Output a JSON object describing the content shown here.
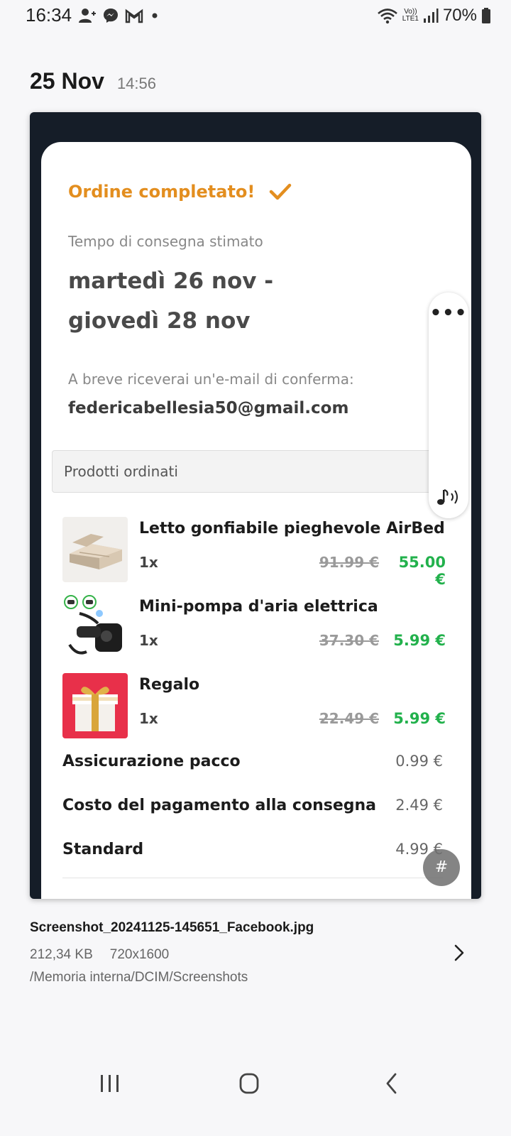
{
  "status_bar": {
    "time": "16:34",
    "notification_icons": [
      "person-add-icon",
      "messenger-icon",
      "gmail-icon",
      "dot-icon"
    ],
    "lte_top": "Vo))",
    "lte_bottom": "LTE1",
    "battery": "70%"
  },
  "gallery": {
    "date": "25 Nov",
    "time": "14:56"
  },
  "order": {
    "title": "Ordine completato!",
    "delivery_label": "Tempo di consegna stimato",
    "delivery_line1": "martedì 26 nov -",
    "delivery_line2": "giovedì 28 nov",
    "email_label": "A breve riceverai un'e-mail di conferma:",
    "email": "federicabellesia50@gmail.com",
    "products_header": "Prodotti ordinati",
    "items": [
      {
        "name": "Letto gonfiabile pieghevole AirBed",
        "qty": "1x",
        "old_price": "91.99 €",
        "new_price": "55.00 €"
      },
      {
        "name": "Mini-pompa d'aria elettrica",
        "qty": "1x",
        "old_price": "37.30 €",
        "new_price": "5.99 €"
      },
      {
        "name": "Regalo",
        "qty": "1x",
        "old_price": "22.49 €",
        "new_price": "5.99 €"
      }
    ],
    "fees": [
      {
        "label": "Assicurazione pacco",
        "value": "0.99 €"
      },
      {
        "label": "Costo del pagamento alla consegna",
        "value": "2.49 €"
      },
      {
        "label": "Standard",
        "value": "4.99 €"
      }
    ]
  },
  "floating": {
    "dots": "•••",
    "hash": "#"
  },
  "file_info": {
    "name": "Screenshot_20241125-145651_Facebook.jpg",
    "size": "212,34 KB",
    "resolution": "720x1600",
    "path": "/Memoria interna/DCIM/Screenshots"
  },
  "colors": {
    "accent_orange": "#e38e1f",
    "price_green": "#22b14c",
    "frame_dark": "#151d28"
  }
}
